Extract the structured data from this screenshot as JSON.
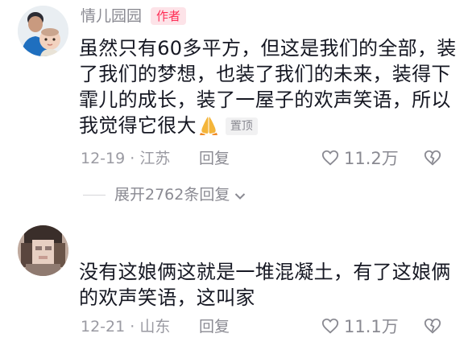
{
  "comment1": {
    "username": "情儿园园",
    "author_badge": "作者",
    "text": "虽然只有60多平方，但这是我们的全部，装了我们的梦想，也装了我们的未来，装得下霏儿的成长，装了一屋子的欢声笑语，所以我觉得它很大",
    "pinned_badge": "置顶",
    "date": "12-19",
    "separator": "·",
    "location": "江苏",
    "reply_label": "回复",
    "likes": "11.2万"
  },
  "expand_replies": "展开2762条回复",
  "comment2": {
    "text": "没有这娘俩这就是一堆混凝土，有了这娘俩的欢声笑语，这叫家",
    "date": "12-21",
    "separator": "·",
    "location": "山东",
    "reply_label": "回复",
    "likes": "11.1万"
  },
  "icons": {
    "like": "heart-outline-icon",
    "dislike": "broken-heart-icon",
    "expand": "chevron-down-icon",
    "emoji": "folded-hands-emoji"
  },
  "colors": {
    "accent": "#fe2c55",
    "text_primary": "#161823",
    "text_secondary": "#8a8a92"
  }
}
